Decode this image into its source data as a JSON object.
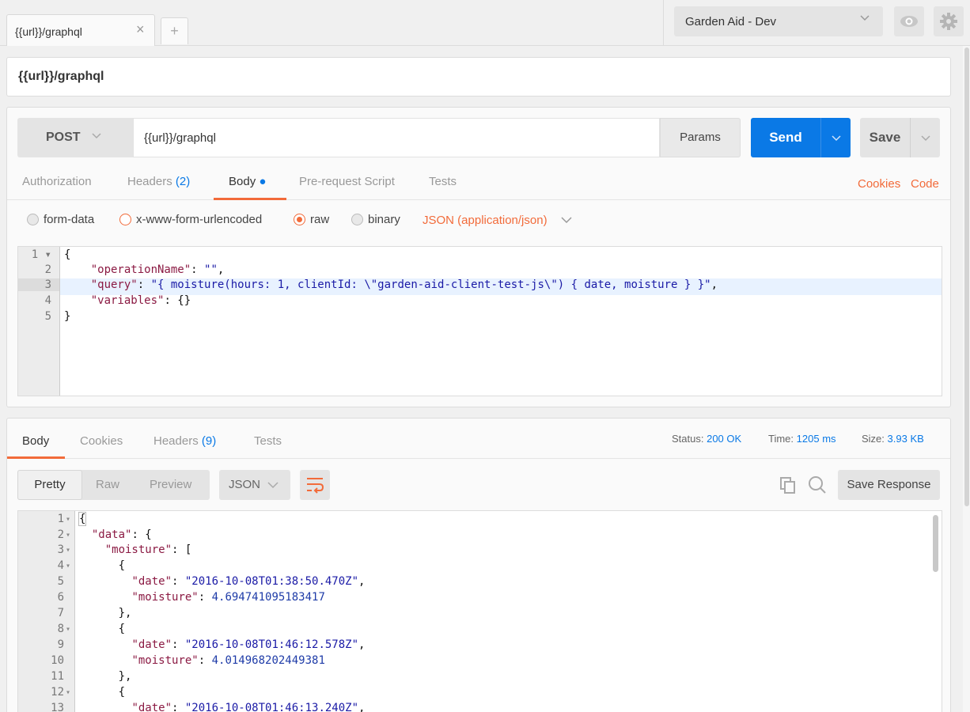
{
  "tabs": [
    {
      "label": "{{url}}/graphql"
    }
  ],
  "new_tab_label": "+",
  "environment": {
    "selected": "Garden Aid - Dev"
  },
  "request": {
    "title": "{{url}}/graphql",
    "method": "POST",
    "url": "{{url}}/graphql",
    "params_label": "Params",
    "send_label": "Send",
    "save_label": "Save",
    "tabs": {
      "authorization": "Authorization",
      "headers": "Headers",
      "headers_count": "(2)",
      "body": "Body",
      "prerequest": "Pre-request Script",
      "tests": "Tests"
    },
    "cookies_link": "Cookies",
    "code_link": "Code",
    "body_modes": [
      "form-data",
      "x-www-form-urlencoded",
      "raw",
      "binary"
    ],
    "selected_body_mode": "raw",
    "content_type": "JSON (application/json)",
    "body_lines": {
      "l1": "{",
      "l2_key": "\"operationName\"",
      "l2_val": "\"\"",
      "l3_key": "\"query\"",
      "l3_val": "\"{ moisture(hours: 1, clientId: \\\"garden-aid-client-test-js\\\") { date, moisture } }\"",
      "l4_key": "\"variables\"",
      "l4_val": "{}",
      "l5": "}"
    }
  },
  "response": {
    "tabs": {
      "body": "Body",
      "cookies": "Cookies",
      "headers": "Headers",
      "headers_count": "(9)",
      "tests": "Tests"
    },
    "status_label": "Status:",
    "status_value": "200 OK",
    "time_label": "Time:",
    "time_value": "1205 ms",
    "size_label": "Size:",
    "size_value": "3.93 KB",
    "view_modes": [
      "Pretty",
      "Raw",
      "Preview"
    ],
    "format": "JSON",
    "save_response_label": "Save Response",
    "lines": {
      "data_key": "\"data\"",
      "moisture_key": "\"moisture\"",
      "date_key": "\"date\"",
      "moisture_field": "\"moisture\"",
      "d1": "\"2016-10-08T01:38:50.470Z\"",
      "m1": "4.694741095183417",
      "d2": "\"2016-10-08T01:46:12.578Z\"",
      "m2": "4.014968202449381",
      "d3": "\"2016-10-08T01:46:13.240Z\""
    }
  },
  "colors": {
    "accent": "#f26b3a",
    "send": "#0a79e6",
    "link_blue": "#0a79e6"
  },
  "icons": [
    "close-icon",
    "plus-icon",
    "chevron-down-icon",
    "eye-icon",
    "gear-icon",
    "wrap-icon",
    "copy-icon",
    "search-icon"
  ]
}
